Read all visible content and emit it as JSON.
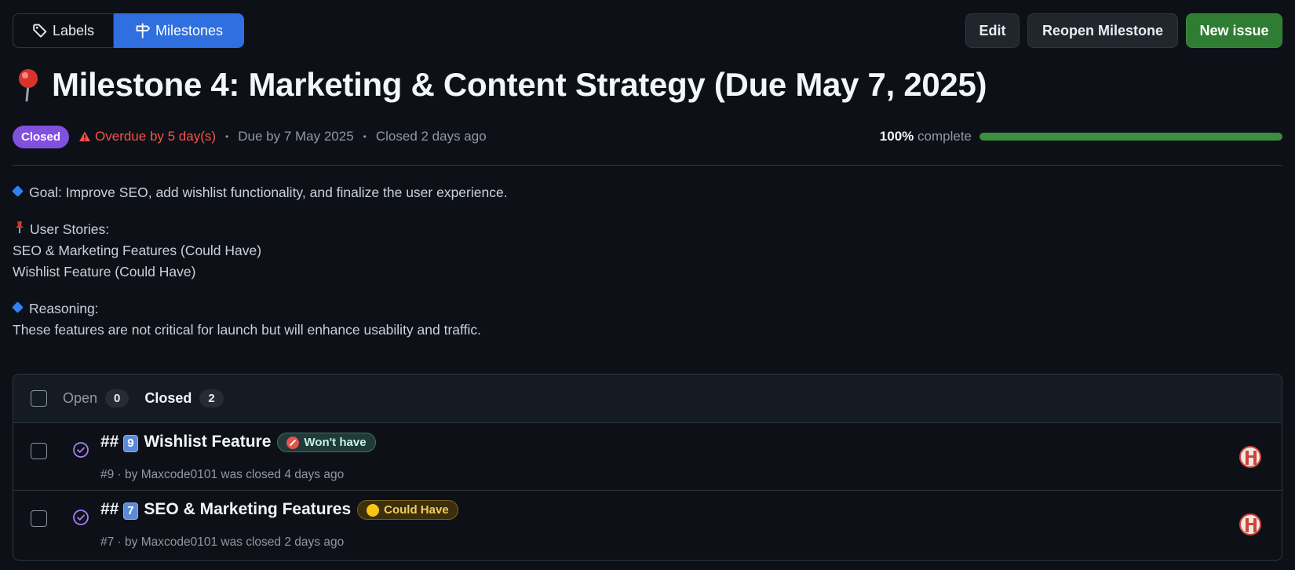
{
  "nav": {
    "labels_label": "Labels",
    "milestones_label": "Milestones"
  },
  "actions": {
    "edit_label": "Edit",
    "reopen_label": "Reopen Milestone",
    "new_issue_label": "New issue"
  },
  "milestone": {
    "title": "Milestone 4: Marketing & Content Strategy (Due May 7, 2025)",
    "state": "Closed",
    "overdue_text": "Overdue by 5 day(s)",
    "due_text": "Due by 7 May 2025",
    "closed_text": "Closed 2 days ago",
    "percent_label": "100%",
    "complete_label": "complete",
    "percent_value": 100
  },
  "description": {
    "goal": "Goal: Improve SEO, add wishlist functionality, and finalize the user experience.",
    "user_stories_heading": "User Stories:",
    "story_1": "SEO & Marketing Features (Could Have)",
    "story_2": "Wishlist Feature (Could Have)",
    "reasoning_heading": "Reasoning:",
    "reasoning_text": "These features are not critical for launch but will enhance usability and traffic."
  },
  "issues": {
    "open_label": "Open",
    "open_count": "0",
    "closed_label": "Closed",
    "closed_count": "2",
    "items": [
      {
        "prefix": "##",
        "keycap": "9",
        "title": "Wishlist Feature",
        "label": "Won't have",
        "meta": "#9 · by Maxcode0101 was closed 4 days ago"
      },
      {
        "prefix": "##",
        "keycap": "7",
        "title": "SEO & Marketing Features",
        "label": "Could Have",
        "meta": "#7 · by Maxcode0101 was closed 2 days ago"
      }
    ]
  },
  "colors": {
    "accent": "#2f6fe0",
    "closed_badge": "#8250df",
    "overdue": "#f85149",
    "progress": "#3b8f3e",
    "new_issue": "#2f7d32"
  }
}
